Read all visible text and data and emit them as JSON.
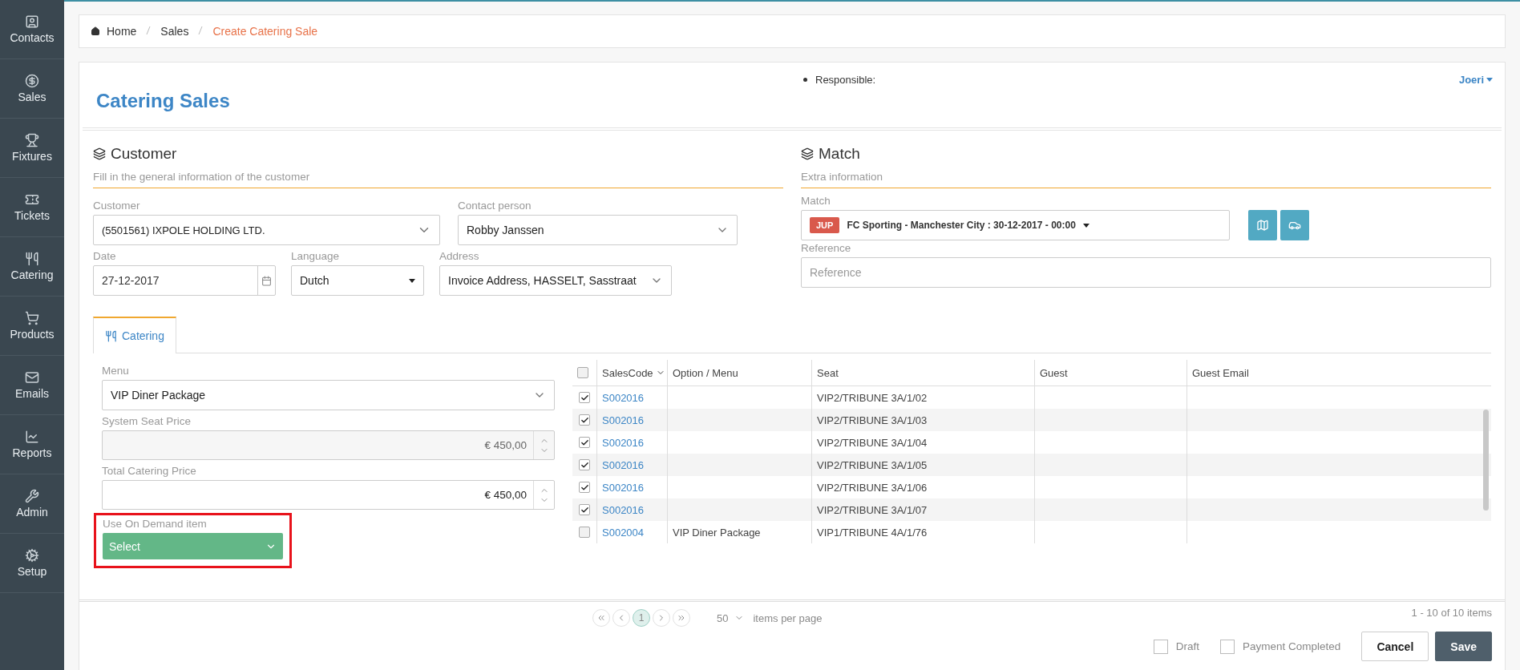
{
  "sidebar": {
    "items": [
      {
        "label": "Contacts",
        "kind": "contacts"
      },
      {
        "label": "Sales",
        "kind": "sales"
      },
      {
        "label": "Fixtures",
        "kind": "fixtures"
      },
      {
        "label": "Tickets",
        "kind": "tickets"
      },
      {
        "label": "Catering",
        "kind": "catering"
      },
      {
        "label": "Products",
        "kind": "products"
      },
      {
        "label": "Emails",
        "kind": "emails"
      },
      {
        "label": "Reports",
        "kind": "reports"
      },
      {
        "label": "Admin",
        "kind": "admin"
      },
      {
        "label": "Setup",
        "kind": "setup"
      }
    ]
  },
  "breadcrumb": [
    {
      "label": "Home",
      "current": false
    },
    {
      "label": "Sales",
      "current": false
    },
    {
      "label": "Create Catering Sale",
      "current": true
    }
  ],
  "header": {
    "title": "Catering Sales",
    "responsible_label": "Responsible:",
    "responsible_user": "Joeri"
  },
  "customer_section": {
    "title": "Customer",
    "subtitle": "Fill in the general information of the customer",
    "customer": {
      "label": "Customer",
      "value": "(5501561) IXPOLE HOLDING LTD."
    },
    "contact_person": {
      "label": "Contact person",
      "value": "Robby Janssen"
    },
    "date": {
      "label": "Date",
      "value": "27-12-2017"
    },
    "language": {
      "label": "Language",
      "value": "Dutch"
    },
    "address": {
      "label": "Address",
      "value": "Invoice Address, HASSELT, Sasstraat"
    }
  },
  "match_section": {
    "title": "Match",
    "subtitle": "Extra information",
    "match": {
      "label": "Match",
      "badge": "JUP",
      "value": "FC Sporting - Manchester City : 30-12-2017 - 00:00"
    },
    "reference": {
      "label": "Reference",
      "placeholder": "Reference"
    }
  },
  "tabs": [
    {
      "label": "Catering",
      "selected": true
    }
  ],
  "catering": {
    "menu": {
      "label": "Menu",
      "value": "VIP Diner Package"
    },
    "system_seat_price": {
      "label": "System Seat Price",
      "value": "€ 450,00",
      "disabled": true
    },
    "total_catering_price": {
      "label": "Total Catering Price",
      "value": "€ 450,00",
      "disabled": false
    },
    "on_demand": {
      "label": "Use On Demand item",
      "value": "Select",
      "highlighted": true
    }
  },
  "table": {
    "all_checked": false,
    "columns": [
      {
        "label": "SalesCode",
        "sortable": true
      },
      {
        "label": "Option / Menu",
        "sortable": false
      },
      {
        "label": "Seat",
        "sortable": false
      },
      {
        "label": "Guest",
        "sortable": false
      },
      {
        "label": "Guest Email",
        "sortable": false
      }
    ],
    "rows": [
      {
        "checked": true,
        "sales_code": "S002016",
        "seat": "VIP2/TRIBUNE 3A/1/02"
      },
      {
        "checked": true,
        "sales_code": "S002016",
        "seat": "VIP2/TRIBUNE 3A/1/03"
      },
      {
        "checked": true,
        "sales_code": "S002016",
        "seat": "VIP2/TRIBUNE 3A/1/04"
      },
      {
        "checked": true,
        "sales_code": "S002016",
        "seat": "VIP2/TRIBUNE 3A/1/05"
      },
      {
        "checked": true,
        "sales_code": "S002016",
        "seat": "VIP2/TRIBUNE 3A/1/06"
      },
      {
        "checked": true,
        "sales_code": "S002016",
        "seat": "VIP2/TRIBUNE 3A/1/07"
      },
      {
        "checked": false,
        "sales_code": "S002004",
        "option": "VIP Diner Package",
        "seat": "VIP1/TRIBUNE 4A/1/76"
      }
    ]
  },
  "pager": {
    "pages": [
      {
        "label": "1",
        "selected": true
      }
    ],
    "page_size": "50",
    "page_size_label": "items per page",
    "summary": "1 - 10 of 10 items"
  },
  "footer": {
    "checkboxes": [
      {
        "label": "Draft",
        "checked": false
      },
      {
        "label": "Payment Completed",
        "checked": false
      }
    ],
    "buttons": [
      {
        "label": "Cancel",
        "kind": "secondary"
      },
      {
        "label": "Save",
        "kind": "primary"
      }
    ]
  }
}
